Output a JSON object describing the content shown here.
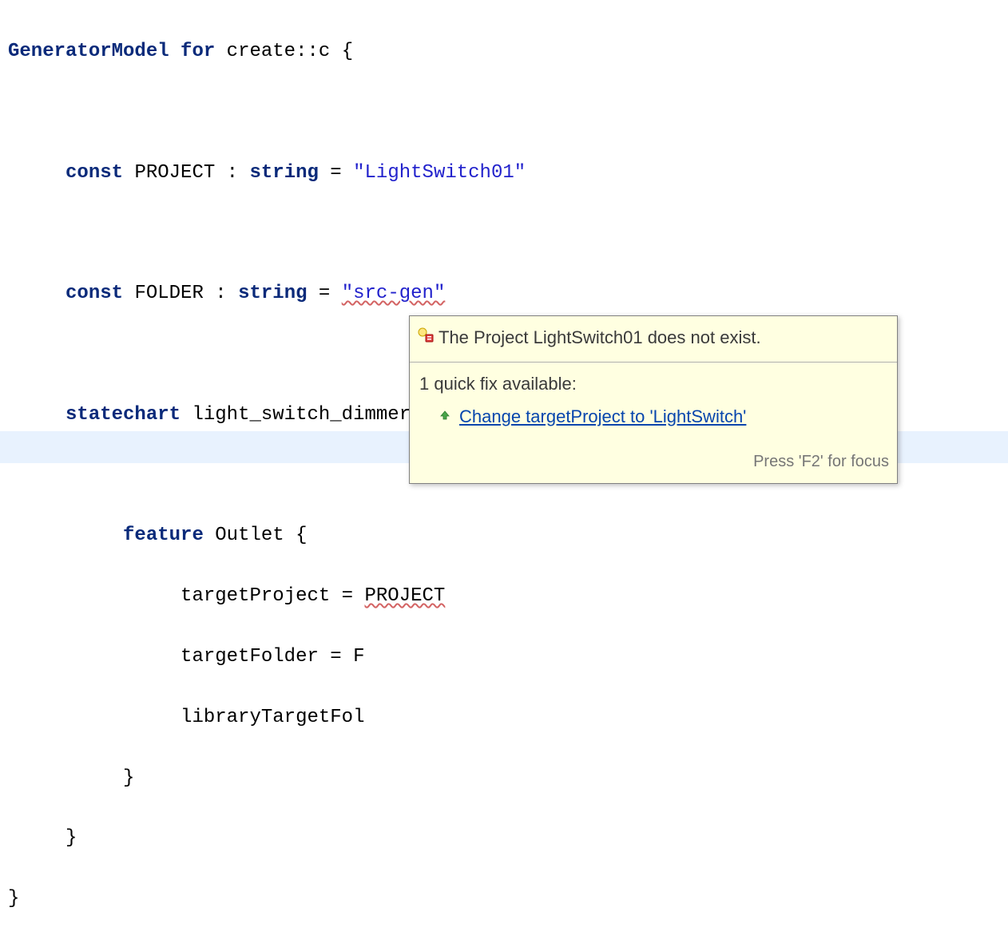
{
  "code": {
    "kw_generatormodel": "GeneratorModel",
    "kw_for": "for",
    "target": "create::c",
    "brace_open": "{",
    "brace_close": "}",
    "kw_const": "const",
    "const1_name": "PROJECT",
    "type_sep": " : ",
    "kw_string": "string",
    "eq": " = ",
    "const1_val": "\"LightSwitch01\"",
    "const2_name": "FOLDER",
    "const2_val": "\"src-gen\"",
    "kw_statechart": "statechart",
    "sc_name": "light_switch_dimmer",
    "kw_feature": "feature",
    "feat_name": "Outlet",
    "p_targetProject": "targetProject",
    "p_targetProject_eq": " = ",
    "p_targetProject_val": "PROJECT",
    "p_targetFolder": "targetFolder",
    "p_targetFolder_eq": " = F",
    "p_libraryTargetFol": "libraryTargetFol"
  },
  "tooltip": {
    "error_message": "The Project LightSwitch01 does not exist.",
    "quickfix_heading": "1 quick fix available:",
    "quickfix_label": "Change targetProject to 'LightSwitch'",
    "footer": "Press 'F2' for focus"
  }
}
